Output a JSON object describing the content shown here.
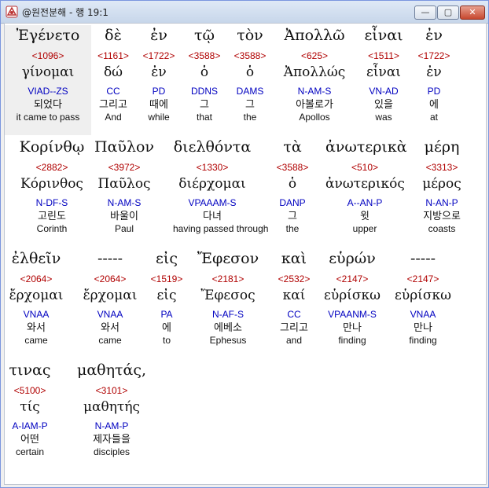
{
  "window": {
    "title": "@원전분해 - 행 19:1",
    "icon": "bible-app-icon",
    "controls": {
      "minimize": "—",
      "maximize": "▢",
      "close": "✕"
    }
  },
  "rows": [
    {
      "words": [
        {
          "greek": "Ἐγένετο",
          "num": "<1096>",
          "lemma": "γίνομαι",
          "parse": "VIAD--ZS",
          "kor": "되었다",
          "eng": "it came to pass",
          "selected": true
        },
        {
          "greek": "δὲ",
          "num": "<1161>",
          "lemma": "δώ",
          "parse": "CC",
          "kor": "그리고",
          "eng": "And"
        },
        {
          "greek": "ἐν",
          "num": "<1722>",
          "lemma": "ἐν",
          "parse": "PD",
          "kor": "때에",
          "eng": "while"
        },
        {
          "greek": "τῷ",
          "num": "<3588>",
          "lemma": "ὁ",
          "parse": "DDNS",
          "kor": "그",
          "eng": "that"
        },
        {
          "greek": "τὸν",
          "num": "<3588>",
          "lemma": "ὁ",
          "parse": "DAMS",
          "kor": "그",
          "eng": "the"
        },
        {
          "greek": "Ἀπολλῶ",
          "num": "<625>",
          "lemma": "Ἀπολλώς",
          "parse": "N-AM-S",
          "kor": "아볼로가",
          "eng": "Apollos"
        },
        {
          "greek": "εἶναι",
          "num": "<1511>",
          "lemma": "εἶναι",
          "parse": "VN-AD",
          "kor": "있을",
          "eng": "was"
        },
        {
          "greek": "ἐν",
          "num": "<1722>",
          "lemma": "ἐν",
          "parse": "PD",
          "kor": "에",
          "eng": "at"
        }
      ]
    },
    {
      "words": [
        {
          "greek": "Κορίνθῳ",
          "num": "<2882>",
          "lemma": "Κόρινθος",
          "parse": "N-DF-S",
          "kor": "고린도",
          "eng": "Corinth"
        },
        {
          "greek": "Παῦλον",
          "num": "<3972>",
          "lemma": "Παῦλος",
          "parse": "N-AM-S",
          "kor": "바울이",
          "eng": "Paul"
        },
        {
          "greek": "διελθόντα",
          "num": "<1330>",
          "lemma": "διέρχομαι",
          "parse": "VPAAAM-S",
          "kor": "다녀",
          "eng": "having passed through"
        },
        {
          "greek": "τὰ",
          "num": "<3588>",
          "lemma": "ὁ",
          "parse": "DANP",
          "kor": "그",
          "eng": "the"
        },
        {
          "greek": "ἀνωτερικὰ",
          "num": "<510>",
          "lemma": "ἀνωτερικός",
          "parse": "A--AN-P",
          "kor": "윗",
          "eng": "upper"
        },
        {
          "greek": "μέρη",
          "num": "<3313>",
          "lemma": "μέρος",
          "parse": "N-AN-P",
          "kor": "지방으로",
          "eng": "coasts"
        }
      ]
    },
    {
      "words": [
        {
          "greek": "ἐλθεῖν",
          "num": "<2064>",
          "lemma": "ἔρχομαι",
          "parse": "VNAA",
          "kor": "와서",
          "eng": "came"
        },
        {
          "greek": "-----",
          "num": "<2064>",
          "lemma": "ἔρχομαι",
          "parse": "VNAA",
          "kor": "와서",
          "eng": "came"
        },
        {
          "greek": "εἰς",
          "num": "<1519>",
          "lemma": "εἰς",
          "parse": "PA",
          "kor": "에",
          "eng": "to"
        },
        {
          "greek": "Ἔφεσον",
          "num": "<2181>",
          "lemma": "Ἔφεσος",
          "parse": "N-AF-S",
          "kor": "에베소",
          "eng": "Ephesus"
        },
        {
          "greek": "καὶ",
          "num": "<2532>",
          "lemma": "καί",
          "parse": "CC",
          "kor": "그리고",
          "eng": "and"
        },
        {
          "greek": "εὑρών",
          "num": "<2147>",
          "lemma": "εὑρίσκω",
          "parse": "VPAANM-S",
          "kor": "만나",
          "eng": "finding"
        },
        {
          "greek": "-----",
          "num": "<2147>",
          "lemma": "εὑρίσκω",
          "parse": "VNAA",
          "kor": "만나",
          "eng": "finding"
        }
      ]
    },
    {
      "words": [
        {
          "greek": "τινας",
          "num": "<5100>",
          "lemma": "τίς",
          "parse": "A-IAM-P",
          "kor": "어떤",
          "eng": "certain"
        },
        {
          "greek": "μαθητάς,",
          "num": "<3101>",
          "lemma": "μαθητής",
          "parse": "N-AM-P",
          "kor": "제자들을",
          "eng": "disciples"
        }
      ]
    }
  ]
}
